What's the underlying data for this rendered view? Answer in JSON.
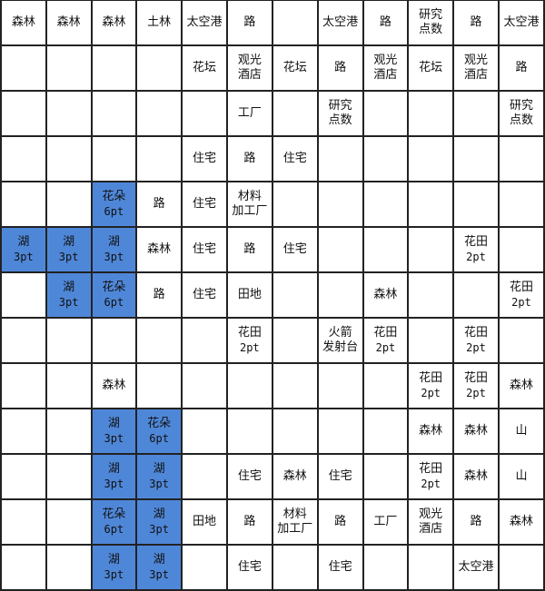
{
  "grid": {
    "rows": 13,
    "cols": 12,
    "highlight_color": "#4f87d8",
    "cells": [
      [
        {
          "t": [
            "森林"
          ]
        },
        {
          "t": [
            "森林"
          ]
        },
        {
          "t": [
            "森林"
          ]
        },
        {
          "t": [
            "土林"
          ]
        },
        {
          "t": [
            "太空港"
          ]
        },
        {
          "t": [
            "路"
          ]
        },
        {
          "t": []
        },
        {
          "t": [
            "太空港"
          ]
        },
        {
          "t": [
            "路"
          ]
        },
        {
          "t": [
            "研究",
            "点数"
          ]
        },
        {
          "t": [
            "路"
          ]
        },
        {
          "t": [
            "太空港"
          ]
        }
      ],
      [
        {
          "t": []
        },
        {
          "t": []
        },
        {
          "t": []
        },
        {
          "t": []
        },
        {
          "t": [
            "花坛"
          ]
        },
        {
          "t": [
            "观光",
            "酒店"
          ]
        },
        {
          "t": [
            "花坛"
          ]
        },
        {
          "t": [
            "路"
          ]
        },
        {
          "t": [
            "观光",
            "酒店"
          ]
        },
        {
          "t": [
            "花坛"
          ]
        },
        {
          "t": [
            "观光",
            "酒店"
          ]
        },
        {
          "t": [
            "路"
          ]
        }
      ],
      [
        {
          "t": []
        },
        {
          "t": []
        },
        {
          "t": []
        },
        {
          "t": []
        },
        {
          "t": []
        },
        {
          "t": [
            "工厂"
          ]
        },
        {
          "t": []
        },
        {
          "t": [
            "研究",
            "点数"
          ]
        },
        {
          "t": []
        },
        {
          "t": []
        },
        {
          "t": []
        },
        {
          "t": [
            "研究",
            "点数"
          ]
        }
      ],
      [
        {
          "t": []
        },
        {
          "t": []
        },
        {
          "t": []
        },
        {
          "t": []
        },
        {
          "t": [
            "住宅"
          ]
        },
        {
          "t": [
            "路"
          ]
        },
        {
          "t": [
            "住宅"
          ]
        },
        {
          "t": []
        },
        {
          "t": []
        },
        {
          "t": []
        },
        {
          "t": []
        },
        {
          "t": []
        }
      ],
      [
        {
          "t": []
        },
        {
          "t": []
        },
        {
          "t": [
            "花朵",
            "6pt"
          ],
          "blue": true
        },
        {
          "t": [
            "路"
          ]
        },
        {
          "t": [
            "住宅"
          ]
        },
        {
          "t": [
            "材料",
            "加工厂"
          ]
        },
        {
          "t": []
        },
        {
          "t": []
        },
        {
          "t": []
        },
        {
          "t": []
        },
        {
          "t": []
        },
        {
          "t": []
        }
      ],
      [
        {
          "t": [
            "湖",
            "3pt"
          ],
          "blue": true
        },
        {
          "t": [
            "湖",
            "3pt"
          ],
          "blue": true
        },
        {
          "t": [
            "湖",
            "3pt"
          ],
          "blue": true
        },
        {
          "t": [
            "森林"
          ]
        },
        {
          "t": [
            "住宅"
          ]
        },
        {
          "t": [
            "路"
          ]
        },
        {
          "t": [
            "住宅"
          ]
        },
        {
          "t": []
        },
        {
          "t": []
        },
        {
          "t": []
        },
        {
          "t": [
            "花田",
            "2pt"
          ]
        },
        {
          "t": []
        }
      ],
      [
        {
          "t": []
        },
        {
          "t": [
            "湖",
            "3pt"
          ],
          "blue": true
        },
        {
          "t": [
            "花朵",
            "6pt"
          ],
          "blue": true
        },
        {
          "t": [
            "路"
          ]
        },
        {
          "t": [
            "住宅"
          ]
        },
        {
          "t": [
            "田地"
          ]
        },
        {
          "t": []
        },
        {
          "t": []
        },
        {
          "t": [
            "森林"
          ]
        },
        {
          "t": []
        },
        {
          "t": []
        },
        {
          "t": [
            "花田",
            "2pt"
          ]
        }
      ],
      [
        {
          "t": []
        },
        {
          "t": []
        },
        {
          "t": []
        },
        {
          "t": []
        },
        {
          "t": []
        },
        {
          "t": [
            "花田",
            "2pt"
          ]
        },
        {
          "t": []
        },
        {
          "t": [
            "火箭",
            "发射台"
          ]
        },
        {
          "t": [
            "花田",
            "2pt"
          ]
        },
        {
          "t": []
        },
        {
          "t": [
            "花田",
            "2pt"
          ]
        },
        {
          "t": []
        }
      ],
      [
        {
          "t": []
        },
        {
          "t": []
        },
        {
          "t": [
            "森林"
          ]
        },
        {
          "t": []
        },
        {
          "t": []
        },
        {
          "t": []
        },
        {
          "t": []
        },
        {
          "t": []
        },
        {
          "t": []
        },
        {
          "t": [
            "花田",
            "2pt"
          ]
        },
        {
          "t": [
            "花田",
            "2pt"
          ]
        },
        {
          "t": [
            "森林"
          ]
        }
      ],
      [
        {
          "t": []
        },
        {
          "t": []
        },
        {
          "t": [
            "湖",
            "3pt"
          ],
          "blue": true
        },
        {
          "t": [
            "花朵",
            "6pt"
          ],
          "blue": true
        },
        {
          "t": []
        },
        {
          "t": []
        },
        {
          "t": []
        },
        {
          "t": []
        },
        {
          "t": []
        },
        {
          "t": [
            "森林"
          ]
        },
        {
          "t": [
            "森林"
          ]
        },
        {
          "t": [
            "山"
          ]
        }
      ],
      [
        {
          "t": []
        },
        {
          "t": []
        },
        {
          "t": [
            "湖",
            "3pt"
          ],
          "blue": true
        },
        {
          "t": [
            "湖",
            "3pt"
          ],
          "blue": true
        },
        {
          "t": []
        },
        {
          "t": [
            "住宅"
          ]
        },
        {
          "t": [
            "森林"
          ]
        },
        {
          "t": [
            "住宅"
          ]
        },
        {
          "t": []
        },
        {
          "t": [
            "花田",
            "2pt"
          ]
        },
        {
          "t": [
            "森林"
          ]
        },
        {
          "t": [
            "山"
          ]
        }
      ],
      [
        {
          "t": []
        },
        {
          "t": []
        },
        {
          "t": [
            "花朵",
            "6pt"
          ],
          "blue": true
        },
        {
          "t": [
            "湖",
            "3pt"
          ],
          "blue": true
        },
        {
          "t": [
            "田地"
          ]
        },
        {
          "t": [
            "路"
          ]
        },
        {
          "t": [
            "材料",
            "加工厂"
          ]
        },
        {
          "t": [
            "路"
          ]
        },
        {
          "t": [
            "工厂"
          ]
        },
        {
          "t": [
            "观光",
            "酒店"
          ]
        },
        {
          "t": [
            "路"
          ]
        },
        {
          "t": [
            "森林"
          ]
        }
      ],
      [
        {
          "t": []
        },
        {
          "t": []
        },
        {
          "t": [
            "湖",
            "3pt"
          ],
          "blue": true
        },
        {
          "t": [
            "湖",
            "3pt"
          ],
          "blue": true
        },
        {
          "t": []
        },
        {
          "t": [
            "住宅"
          ]
        },
        {
          "t": []
        },
        {
          "t": [
            "住宅"
          ]
        },
        {
          "t": []
        },
        {
          "t": []
        },
        {
          "t": [
            "太空港"
          ]
        },
        {
          "t": []
        }
      ]
    ]
  }
}
